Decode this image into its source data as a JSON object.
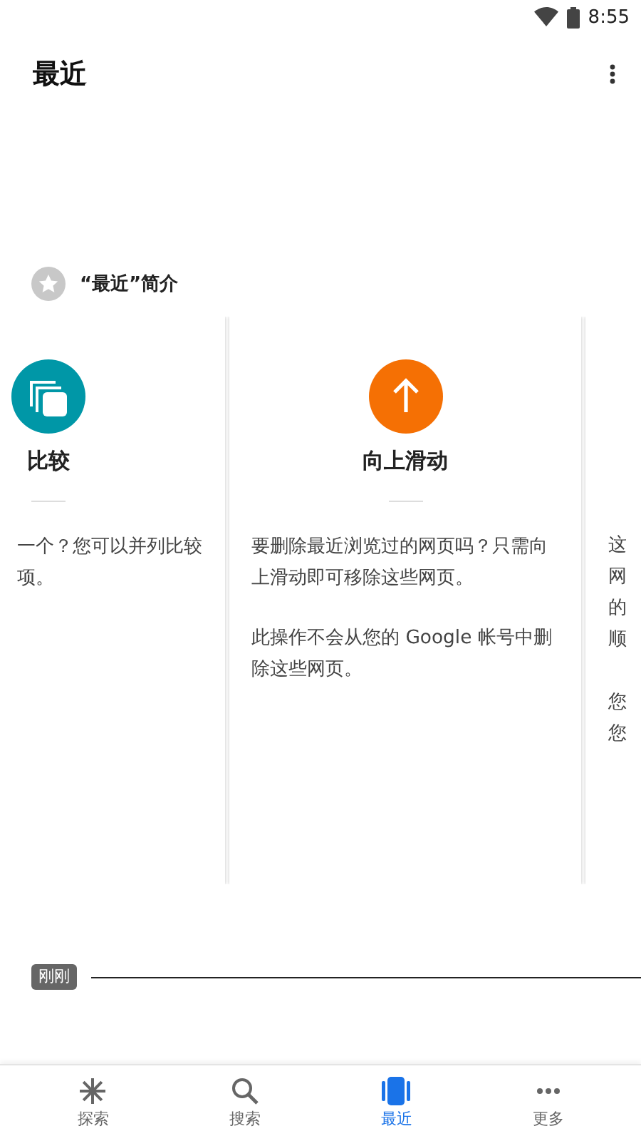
{
  "status_bar": {
    "time": "8:55"
  },
  "app_bar": {
    "title": "最近"
  },
  "intro": {
    "title": "“最近”简介",
    "cards": [
      {
        "kind": "compare",
        "title": "比较",
        "paragraphs": [
          [
            "一个？您可以并列比较",
            "项。"
          ]
        ]
      },
      {
        "kind": "swipe",
        "title": "向上滑动",
        "paragraphs": [
          [
            "要删除最近浏览过的网页吗？只需向上滑动即可移除这些网页。"
          ],
          [
            "此操作不会从您的 Google 帐号中删除这些网页。"
          ]
        ]
      },
      {
        "kind": "partial",
        "paragraphs": [
          [
            "这",
            "网",
            "的",
            "顺"
          ],
          [
            "您",
            "您"
          ]
        ]
      }
    ]
  },
  "timeline": {
    "label": "刚刚"
  },
  "bottom_nav": [
    {
      "kind": "explore",
      "label": "探索",
      "selected": false
    },
    {
      "kind": "search",
      "label": "搜索",
      "selected": false
    },
    {
      "kind": "recent",
      "label": "最近",
      "selected": true
    },
    {
      "kind": "more",
      "label": "更多",
      "selected": false
    }
  ]
}
